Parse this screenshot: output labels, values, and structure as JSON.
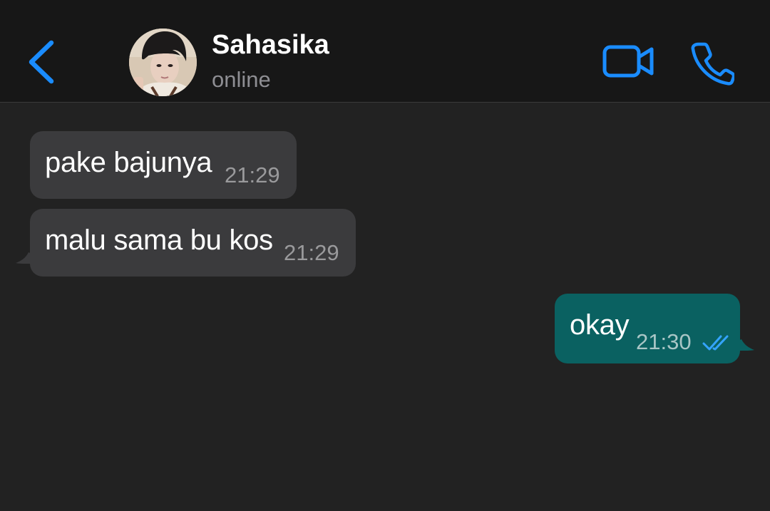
{
  "header": {
    "contact_name": "Sahasika",
    "status": "online",
    "back_icon": "chevron-left-icon",
    "video_icon": "video-camera-icon",
    "phone_icon": "phone-icon",
    "accent_color": "#1a8cff"
  },
  "messages": [
    {
      "direction": "incoming",
      "text": "pake bajunya",
      "time": "21:29"
    },
    {
      "direction": "incoming",
      "text": "malu sama bu kos",
      "time": "21:29"
    },
    {
      "direction": "outgoing",
      "text": "okay",
      "time": "21:30",
      "status": "read",
      "status_icon": "double-check-icon"
    }
  ],
  "colors": {
    "background": "#222222",
    "header_background": "#171717",
    "incoming_bubble": "#3b3b3d",
    "outgoing_bubble": "#0a6161",
    "read_ticks": "#34a4ff"
  }
}
